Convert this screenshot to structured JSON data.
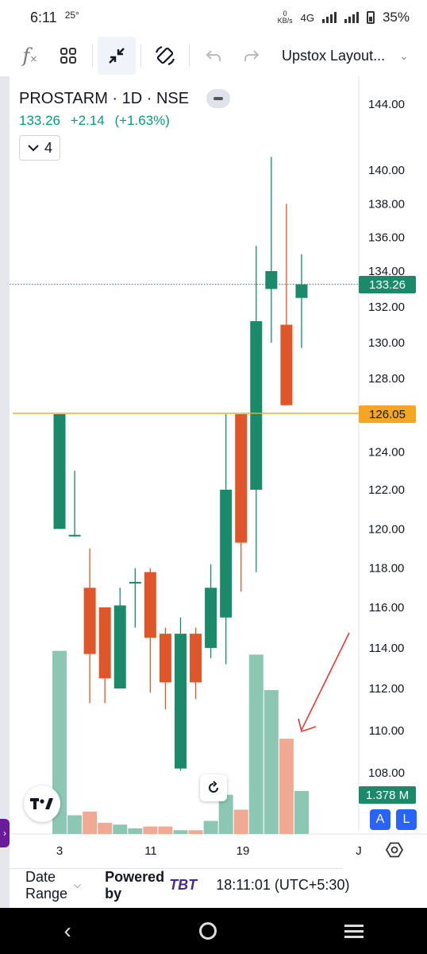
{
  "status": {
    "time": "6:11",
    "temp": "25°",
    "net_speed_value": "0",
    "net_speed_unit": "KB/s",
    "network": "4G",
    "battery": "35%"
  },
  "toolbar": {
    "layout_name": "Upstox Layout..."
  },
  "legend": {
    "title": "PROSTARM · 1D · NSE",
    "price": "133.26",
    "change": "+2.14",
    "change_pct": "(+1.63%)",
    "indicators_count": "4"
  },
  "tags": {
    "last_price": "133.26",
    "line_price": "126.05",
    "volume": "1.378 M"
  },
  "scale_buttons": {
    "auto": "A",
    "log": "L"
  },
  "bottom": {
    "date_range": "Date Range",
    "powered_by": "Powered by",
    "brand": "TBT",
    "clock": "18:11:01 (UTC+5:30)"
  },
  "colors": {
    "up": "#1a8a6a",
    "down": "#e0562b",
    "vol_up": "#8cc7b4",
    "vol_down": "#f0aa93",
    "line": "#f5a623",
    "last_tag": "#1a8a6a",
    "line_tag": "#f5a623"
  },
  "chart_data": {
    "type": "candlestick",
    "y_ticks": [
      "144.00",
      "140.00",
      "138.00",
      "136.00",
      "134.00",
      "132.00",
      "130.00",
      "128.00",
      "124.00",
      "122.00",
      "120.00",
      "118.00",
      "116.00",
      "114.00",
      "112.00",
      "110.00",
      "108.00"
    ],
    "x_ticks": [
      "3",
      "11",
      "19",
      "J"
    ],
    "horizontal_line": 126.05,
    "last_price": 133.26,
    "candles": [
      {
        "o": 120.0,
        "h": 126.0,
        "l": 120.0,
        "c": 126.0,
        "v": 0.98
      },
      {
        "o": 119.7,
        "h": 123.0,
        "l": 119.6,
        "c": 119.7,
        "v": 0.1
      },
      {
        "o": 117.0,
        "h": 119.0,
        "l": 111.3,
        "c": 113.7,
        "v": 0.12
      },
      {
        "o": 116.0,
        "h": 116.0,
        "l": 111.3,
        "c": 112.5,
        "v": 0.06
      },
      {
        "o": 112.0,
        "h": 117.0,
        "l": 112.0,
        "c": 116.1,
        "v": 0.05
      },
      {
        "o": 117.3,
        "h": 118.0,
        "l": 115.0,
        "c": 117.3,
        "v": 0.03
      },
      {
        "o": 117.8,
        "h": 118.0,
        "l": 111.8,
        "c": 114.5,
        "v": 0.04
      },
      {
        "o": 114.7,
        "h": 115.0,
        "l": 111.0,
        "c": 112.3,
        "v": 0.04
      },
      {
        "o": 108.2,
        "h": 115.5,
        "l": 108.1,
        "c": 114.7,
        "v": 0.02
      },
      {
        "o": 114.7,
        "h": 115.0,
        "l": 111.5,
        "c": 112.3,
        "v": 0.02
      },
      {
        "o": 114.0,
        "h": 118.2,
        "l": 113.5,
        "c": 117.0,
        "v": 0.07
      },
      {
        "o": 115.5,
        "h": 126.0,
        "l": 113.2,
        "c": 122.0,
        "v": 0.21
      },
      {
        "o": 126.0,
        "h": 126.0,
        "l": 116.8,
        "c": 119.3,
        "v": 0.13
      },
      {
        "o": 122.0,
        "h": 135.5,
        "l": 117.8,
        "c": 131.2,
        "v": 0.96
      },
      {
        "o": 133.0,
        "h": 140.8,
        "l": 130.0,
        "c": 134.0,
        "v": 0.77
      },
      {
        "o": 131.0,
        "h": 138.0,
        "l": 126.5,
        "c": 126.5,
        "v": 0.51
      },
      {
        "o": 132.5,
        "h": 135.0,
        "l": 129.7,
        "c": 133.26,
        "v": 0.23
      }
    ]
  }
}
